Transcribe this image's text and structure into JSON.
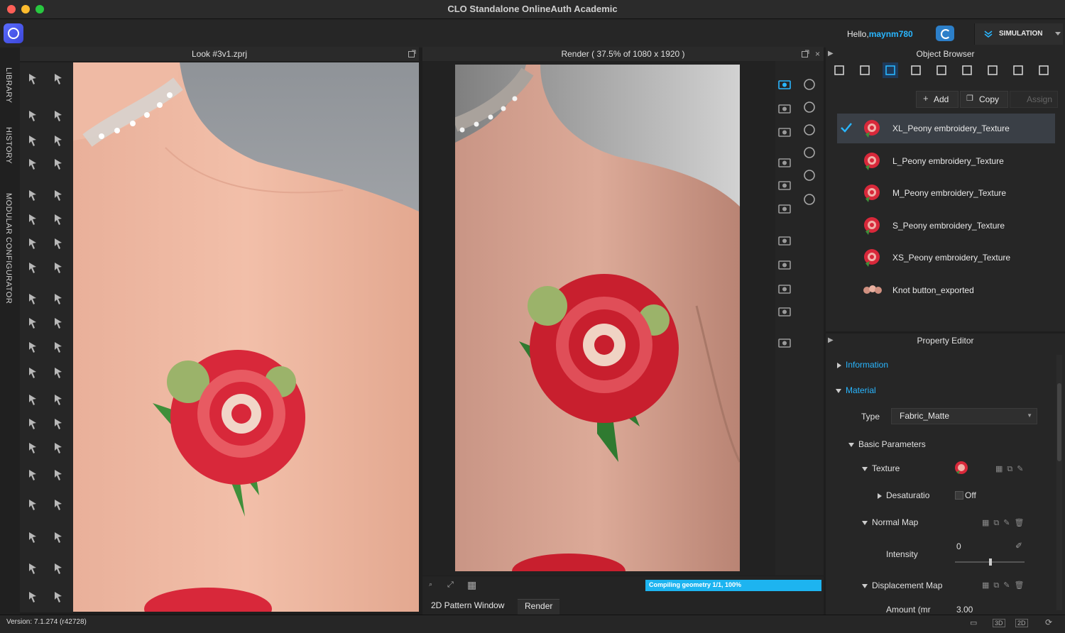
{
  "window": {
    "title": "CLO Standalone OnlineAuth Academic"
  },
  "header": {
    "greeting": "Hello,",
    "username": "maynm780",
    "mode_button": "SIMULATION"
  },
  "left_tabs": [
    "LIBRARY",
    "HISTORY",
    "MODULAR CONFIGURATOR"
  ],
  "viewport_3d": {
    "title": "Look #3v1.zprj"
  },
  "render_window": {
    "title": "Render ( 37.5% of 1080 x 1920 )",
    "progress_text": "Compiling geometry 1/1, 100%",
    "progress": 1.0
  },
  "bottom_tabs": [
    "2D Pattern Window",
    "Render"
  ],
  "object_browser": {
    "title": "Object Browser",
    "add_label": "Add",
    "copy_label": "Copy",
    "assign_label": "Assign",
    "items": [
      {
        "label": "XL_Peony embroidery_Texture",
        "selected": true
      },
      {
        "label": "L_Peony embroidery_Texture"
      },
      {
        "label": "M_Peony embroidery_Texture"
      },
      {
        "label": "S_Peony embroidery_Texture"
      },
      {
        "label": "XS_Peony embroidery_Texture"
      },
      {
        "label": "Knot button_exported"
      }
    ]
  },
  "property_editor": {
    "title": "Property Editor",
    "information": "Information",
    "material": "Material",
    "type_label": "Type",
    "type_value": "Fabric_Matte",
    "basic_parameters": "Basic Parameters",
    "texture": "Texture",
    "desaturation": "Desaturatio",
    "desaturation_value": "Off",
    "normal_map": "Normal Map",
    "intensity": "Intensity",
    "intensity_value": "0",
    "displacement_map": "Displacement Map",
    "amount": "Amount (mr",
    "amount_value": "3.00"
  },
  "status": {
    "version": "Version: 7.1.274 (r42728)"
  },
  "colors": {
    "accent": "#29b6ff",
    "skin": "#f0b9a3",
    "rose": "#d8283a",
    "leaf": "#3f8f3a"
  }
}
